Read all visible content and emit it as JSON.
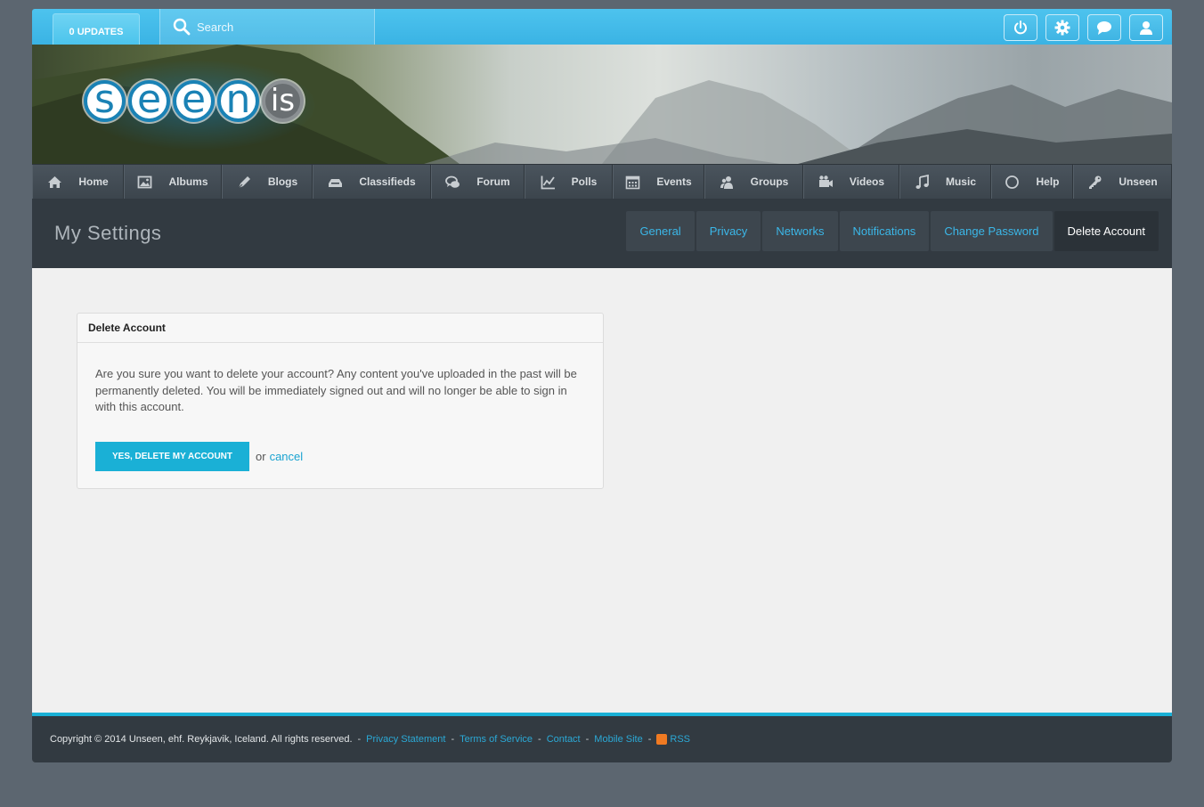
{
  "topbar": {
    "updates_label": "0 UPDATES",
    "search_placeholder": "Search",
    "icons": [
      "power-icon",
      "gear-icon",
      "chat-icon",
      "user-icon"
    ]
  },
  "logo": {
    "letters": [
      "s",
      "e",
      "e",
      "n",
      "is"
    ]
  },
  "nav": {
    "items": [
      {
        "label": "Home",
        "icon": "home-icon"
      },
      {
        "label": "Albums",
        "icon": "image-icon"
      },
      {
        "label": "Blogs",
        "icon": "pen-icon"
      },
      {
        "label": "Classifieds",
        "icon": "tray-icon"
      },
      {
        "label": "Forum",
        "icon": "forum-icon"
      },
      {
        "label": "Polls",
        "icon": "chart-icon"
      },
      {
        "label": "Events",
        "icon": "calendar-icon"
      },
      {
        "label": "Groups",
        "icon": "group-icon"
      },
      {
        "label": "Videos",
        "icon": "video-icon"
      },
      {
        "label": "Music",
        "icon": "music-icon"
      },
      {
        "label": "Help",
        "icon": "circle-icon"
      },
      {
        "label": "Unseen",
        "icon": "key-icon"
      }
    ]
  },
  "settings": {
    "title": "My Settings",
    "tabs": [
      {
        "label": "General"
      },
      {
        "label": "Privacy"
      },
      {
        "label": "Networks"
      },
      {
        "label": "Notifications"
      },
      {
        "label": "Change Password"
      },
      {
        "label": "Delete Account",
        "active": true
      }
    ]
  },
  "delete_box": {
    "title": "Delete Account",
    "message": "Are you sure you want to delete your account? Any content you've uploaded in the past will be permanently deleted. You will be immediately signed out and will no longer be able to sign in with this account.",
    "confirm_label": "YES, DELETE MY ACCOUNT",
    "or_text": "or",
    "cancel_label": "cancel"
  },
  "footer": {
    "copyright": "Copyright © 2014 Unseen, ehf. Reykjavik, Iceland. All rights reserved.",
    "separator": "-",
    "links": [
      "Privacy Statement",
      "Terms of Service",
      "Contact",
      "Mobile Site",
      "RSS"
    ]
  },
  "colors": {
    "accent": "#1ab0d6",
    "topbar": "#3ab3e4",
    "nav_bg": "#3c454d",
    "header_bg": "#323a41"
  }
}
